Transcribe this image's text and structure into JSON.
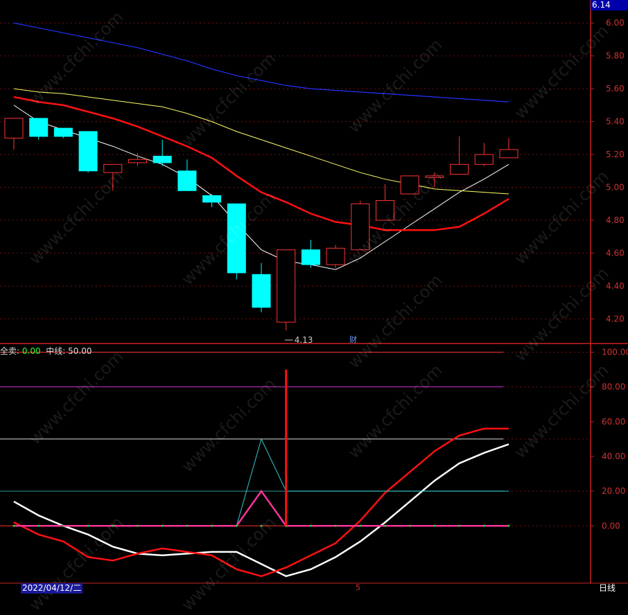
{
  "header": {
    "top_price": "6.14"
  },
  "indicator": {
    "sell_label": "全卖:",
    "sell_value": "0.00",
    "mid_label": "中线:",
    "mid_value": "50.00"
  },
  "footer": {
    "date": "2022/04/12/二",
    "period": "日线",
    "marker": "5"
  },
  "finance_mark": "财",
  "watermark": "www.cfchi.com",
  "colors": {
    "up": "#ff3333",
    "down": "#00ffff",
    "axis": "#cc2222",
    "ma_white": "#ffffff",
    "ma_yellow": "#ffff66",
    "ma_red": "#ff1111",
    "ma_blue": "#2233ff"
  },
  "chart_data": [
    {
      "type": "candlestick",
      "ylim": [
        4.05,
        6.14
      ],
      "y_ticks": [
        "4.20",
        "4.40",
        "4.60",
        "4.80",
        "5.00",
        "5.20",
        "5.40",
        "5.60",
        "5.80",
        "6.00"
      ],
      "low_annotation": "4.13",
      "candles": [
        {
          "o": 5.3,
          "h": 5.42,
          "l": 5.23,
          "c": 5.42
        },
        {
          "o": 5.42,
          "h": 5.42,
          "l": 5.29,
          "c": 5.31
        },
        {
          "o": 5.36,
          "h": 5.36,
          "l": 5.3,
          "c": 5.31
        },
        {
          "o": 5.34,
          "h": 5.34,
          "l": 5.09,
          "c": 5.1
        },
        {
          "o": 5.09,
          "h": 5.14,
          "l": 4.98,
          "c": 5.14
        },
        {
          "o": 5.15,
          "h": 5.21,
          "l": 5.13,
          "c": 5.17
        },
        {
          "o": 5.19,
          "h": 5.29,
          "l": 5.13,
          "c": 5.15
        },
        {
          "o": 5.1,
          "h": 5.17,
          "l": 4.98,
          "c": 4.98
        },
        {
          "o": 4.95,
          "h": 4.96,
          "l": 4.88,
          "c": 4.91
        },
        {
          "o": 4.9,
          "h": 4.9,
          "l": 4.44,
          "c": 4.48
        },
        {
          "o": 4.47,
          "h": 4.54,
          "l": 4.24,
          "c": 4.27
        },
        {
          "o": 4.18,
          "h": 4.62,
          "l": 4.13,
          "c": 4.62
        },
        {
          "o": 4.62,
          "h": 4.68,
          "l": 4.51,
          "c": 4.53
        },
        {
          "o": 4.53,
          "h": 4.65,
          "l": 4.51,
          "c": 4.63
        },
        {
          "o": 4.62,
          "h": 4.92,
          "l": 4.62,
          "c": 4.9
        },
        {
          "o": 4.8,
          "h": 5.02,
          "l": 4.8,
          "c": 4.92
        },
        {
          "o": 4.96,
          "h": 5.07,
          "l": 4.96,
          "c": 5.07
        },
        {
          "o": 5.06,
          "h": 5.09,
          "l": 5.0,
          "c": 5.07
        },
        {
          "o": 5.08,
          "h": 5.31,
          "l": 5.08,
          "c": 5.14
        },
        {
          "o": 5.14,
          "h": 5.27,
          "l": 5.13,
          "c": 5.2
        },
        {
          "o": 5.18,
          "h": 5.3,
          "l": 5.18,
          "c": 5.23
        }
      ],
      "series": [
        {
          "values": [
            5.5,
            5.4,
            5.35,
            5.3,
            5.25,
            5.19,
            5.14,
            5.06,
            4.95,
            4.78,
            4.62,
            4.55,
            4.53,
            4.5,
            4.57,
            4.67,
            4.77,
            4.87,
            4.97,
            5.05,
            5.14
          ]
        },
        {
          "values": [
            5.6,
            5.58,
            5.57,
            5.55,
            5.53,
            5.51,
            5.49,
            5.45,
            5.4,
            5.34,
            5.29,
            5.24,
            5.19,
            5.14,
            5.09,
            5.05,
            5.02,
            4.99,
            4.98,
            4.97,
            4.96
          ]
        },
        {
          "values": [
            5.55,
            5.52,
            5.5,
            5.46,
            5.42,
            5.37,
            5.31,
            5.25,
            5.18,
            5.07,
            4.97,
            4.91,
            4.84,
            4.79,
            4.77,
            4.74,
            4.74,
            4.74,
            4.76,
            4.84,
            4.93
          ]
        },
        {
          "values": [
            6.0,
            5.97,
            5.94,
            5.91,
            5.88,
            5.85,
            5.81,
            5.77,
            5.72,
            5.68,
            5.65,
            5.62,
            5.6,
            5.59,
            5.58,
            5.57,
            5.56,
            5.55,
            5.54,
            5.53,
            5.52
          ]
        }
      ]
    },
    {
      "type": "line",
      "ylim": [
        -33,
        105
      ],
      "y_ticks": [
        "0.00",
        "20.00",
        "40.00",
        "60.00",
        "80.00",
        "100.00"
      ],
      "hlines": [
        100,
        80,
        50,
        20,
        0
      ],
      "series": [
        {
          "values": [
            14,
            6,
            0,
            -5,
            -12,
            -16,
            -17,
            -16,
            -15,
            -15,
            -22,
            -29,
            -25,
            -18,
            -9,
            2,
            14,
            26,
            36,
            42,
            47
          ]
        },
        {
          "values": [
            2,
            -5,
            -9,
            -18,
            -20,
            -16,
            -13,
            -15,
            -17,
            -25,
            -29,
            -24,
            -17,
            -10,
            3,
            19,
            31,
            43,
            52,
            56,
            56
          ]
        },
        {
          "values": [
            0,
            0,
            0,
            0,
            0,
            0,
            0,
            0,
            0,
            0,
            50,
            20,
            20,
            20,
            20,
            20,
            20,
            20,
            20,
            20,
            20
          ]
        },
        {
          "values": [
            0,
            0,
            0,
            0,
            0,
            0,
            0,
            0,
            0,
            0,
            20,
            0,
            0,
            0,
            0,
            0,
            0,
            0,
            0,
            0,
            0
          ]
        }
      ],
      "signal": {
        "index": 11,
        "value": 90
      }
    }
  ]
}
